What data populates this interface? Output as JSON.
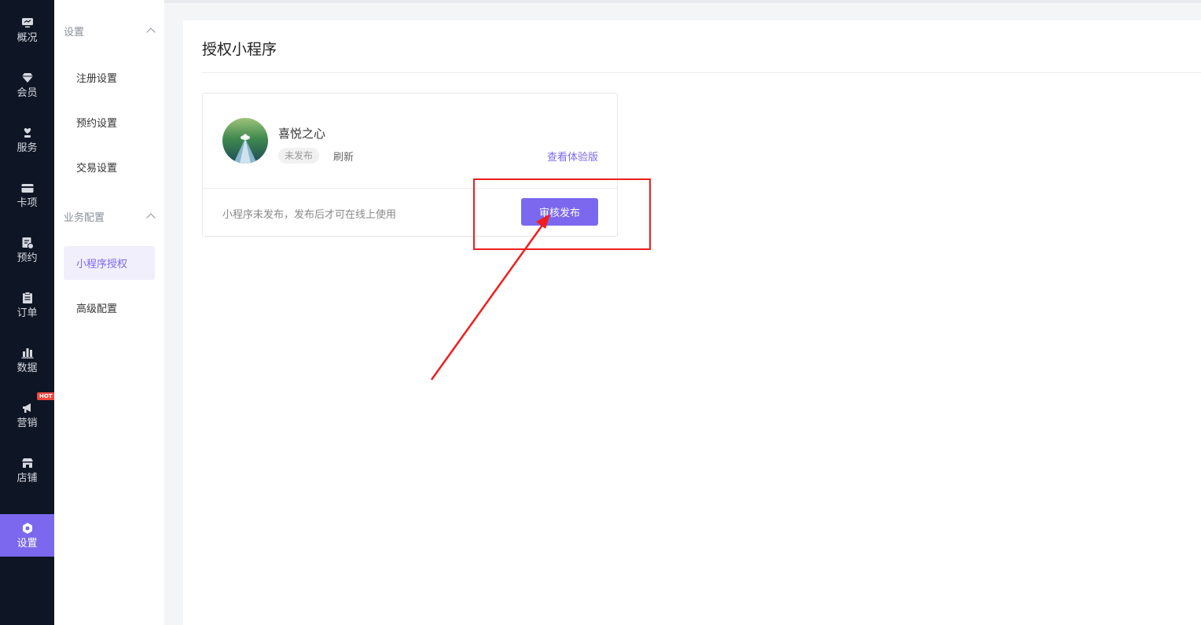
{
  "nav": {
    "items": [
      {
        "label": "概况",
        "icon": "monitor-icon"
      },
      {
        "label": "会员",
        "icon": "diamond-icon"
      },
      {
        "label": "服务",
        "icon": "heart-hand-icon"
      },
      {
        "label": "卡项",
        "icon": "card-icon"
      },
      {
        "label": "预约",
        "icon": "calendar-clock-icon"
      },
      {
        "label": "订单",
        "icon": "clipboard-icon"
      },
      {
        "label": "数据",
        "icon": "bar-chart-icon"
      },
      {
        "label": "营销",
        "icon": "megaphone-icon",
        "badge": "HOT"
      },
      {
        "label": "店铺",
        "icon": "store-icon"
      },
      {
        "label": "设置",
        "icon": "gear-icon",
        "active": true
      }
    ]
  },
  "submenu": {
    "group1": {
      "label": "设置",
      "items": [
        "注册设置",
        "预约设置",
        "交易设置"
      ]
    },
    "group2": {
      "label": "业务配置",
      "items": [
        "小程序授权",
        "高级配置"
      ],
      "active": "小程序授权"
    }
  },
  "main": {
    "title": "授权小程序",
    "card": {
      "app_name": "喜悦之心",
      "status": "未发布",
      "refresh": "刷新",
      "view_trial": "查看体验版",
      "hint": "小程序未发布，发布后才可在线上使用",
      "publish_button": "审核发布"
    }
  },
  "colors": {
    "accent": "#7b68ee",
    "nav_bg": "#0e1524",
    "highlight": "#f01e1e"
  }
}
